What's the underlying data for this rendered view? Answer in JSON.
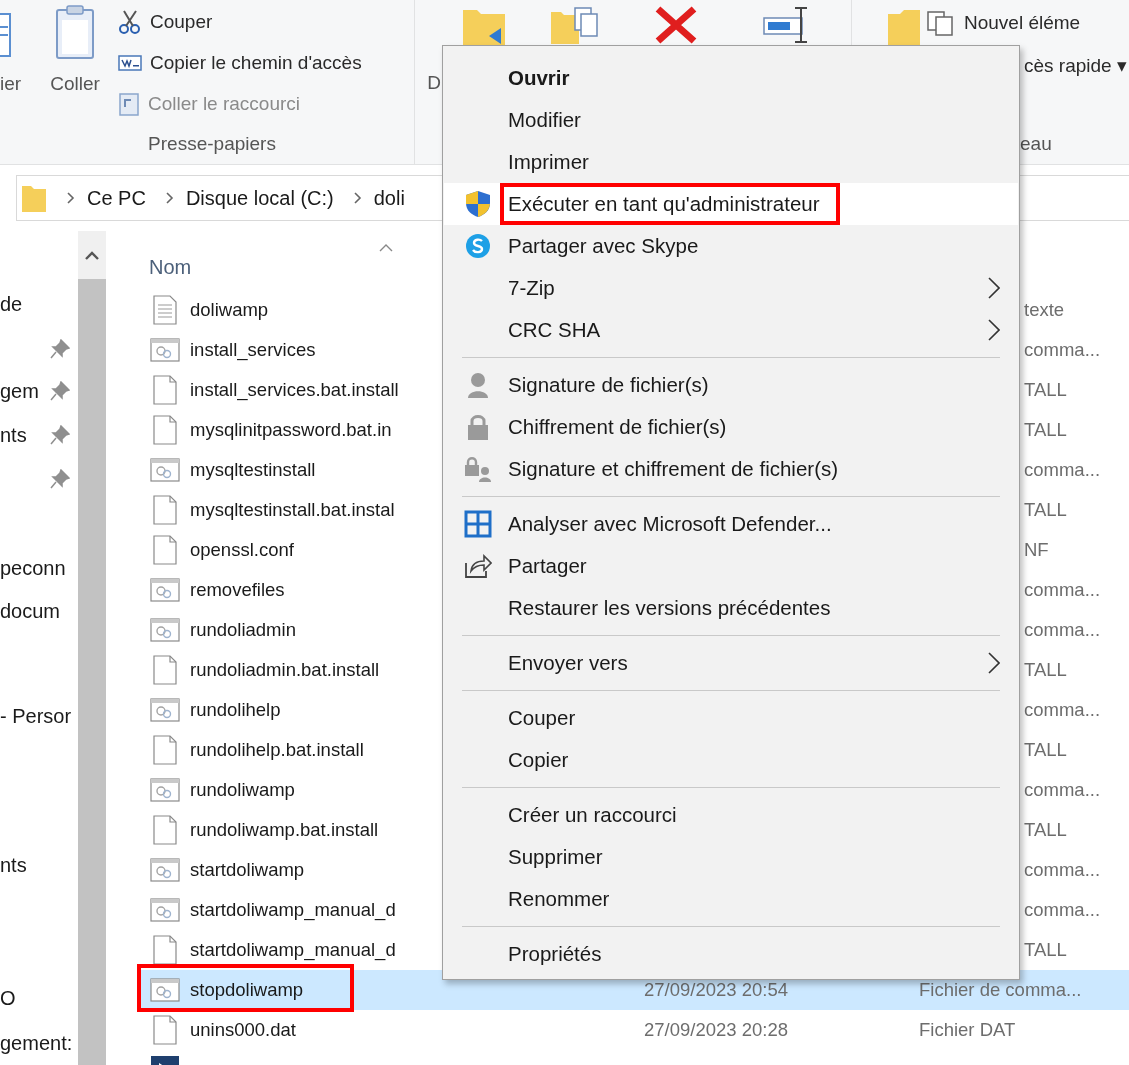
{
  "ribbon": {
    "clipboard": {
      "cut_label": "ier",
      "paste": "Coller",
      "actions": [
        {
          "label": "Couper",
          "disabled": false
        },
        {
          "label": "Copier le chemin d'accès",
          "disabled": false
        },
        {
          "label": "Coller le raccourci",
          "disabled": true
        }
      ],
      "group_label": "Presse-papiers"
    },
    "organize": {
      "cut_label": "D"
    },
    "new": {
      "actions": [
        "Nouvel éléme",
        "cès rapide ▾"
      ],
      "group_label": "eau"
    }
  },
  "address": {
    "crumbs": [
      "Ce PC",
      "Disque local (C:)",
      "doli"
    ]
  },
  "nav_pane": {
    "items": [
      {
        "label": "de",
        "pinned": false
      },
      {
        "pinned": true
      },
      {
        "label": "gem",
        "pinned": true
      },
      {
        "label": "nts",
        "pinned": true
      },
      {
        "pinned": true
      },
      {
        "label": "peconn",
        "pinned": false
      },
      {
        "label": "docum",
        "pinned": false
      },
      {
        "label": "- Persor",
        "pinned": false
      },
      {
        "label": "nts",
        "pinned": false
      },
      {
        "label": "O",
        "pinned": false
      },
      {
        "label": "gement:",
        "pinned": false
      }
    ]
  },
  "files": {
    "column": "Nom",
    "rows": [
      {
        "kind": "text",
        "name": "doliwamp",
        "type": "texte",
        "selected": false,
        "annotated": false
      },
      {
        "kind": "batch",
        "name": "install_services",
        "type": "comma...",
        "selected": false,
        "annotated": false
      },
      {
        "kind": "blank",
        "name": "install_services.bat.install",
        "type": "TALL",
        "selected": false,
        "annotated": false
      },
      {
        "kind": "blank",
        "name": "mysqlinitpassword.bat.in",
        "type": "TALL",
        "selected": false,
        "annotated": false
      },
      {
        "kind": "batch",
        "name": "mysqltestinstall",
        "type": "comma...",
        "selected": false,
        "annotated": false
      },
      {
        "kind": "blank",
        "name": "mysqltestinstall.bat.instal",
        "type": "TALL",
        "selected": false,
        "annotated": false
      },
      {
        "kind": "blank",
        "name": "openssl.conf",
        "type": "NF",
        "selected": false,
        "annotated": false
      },
      {
        "kind": "batch",
        "name": "removefiles",
        "type": "comma...",
        "selected": false,
        "annotated": false
      },
      {
        "kind": "batch",
        "name": "rundoliadmin",
        "type": "comma...",
        "selected": false,
        "annotated": false
      },
      {
        "kind": "blank",
        "name": "rundoliadmin.bat.install",
        "type": "TALL",
        "selected": false,
        "annotated": false
      },
      {
        "kind": "batch",
        "name": "rundolihelp",
        "type": "comma...",
        "selected": false,
        "annotated": false
      },
      {
        "kind": "blank",
        "name": "rundolihelp.bat.install",
        "type": "TALL",
        "selected": false,
        "annotated": false
      },
      {
        "kind": "batch",
        "name": "rundoliwamp",
        "type": "comma...",
        "selected": false,
        "annotated": false
      },
      {
        "kind": "blank",
        "name": "rundoliwamp.bat.install",
        "type": "TALL",
        "selected": false,
        "annotated": false
      },
      {
        "kind": "batch",
        "name": "startdoliwamp",
        "type": "comma...",
        "selected": false,
        "annotated": false
      },
      {
        "kind": "batch",
        "name": "startdoliwamp_manual_d",
        "type": "comma...",
        "selected": false,
        "annotated": false
      },
      {
        "kind": "blank",
        "name": "startdoliwamp_manual_d",
        "type": "TALL",
        "selected": false,
        "annotated": false
      },
      {
        "kind": "batch",
        "name": "stopdoliwamp",
        "date": "27/09/2023 20:54",
        "type": "Fichier de comma...",
        "selected": true,
        "annotated": true
      },
      {
        "kind": "blank",
        "name": "unins000.dat",
        "date": "27/09/2023 20:28",
        "type": "Fichier DAT",
        "selected": false,
        "annotated": false
      },
      {
        "kind": "app",
        "selected": false,
        "annotated": false
      }
    ]
  },
  "context_menu": {
    "items": [
      {
        "kind": "item",
        "label": "Ouvrir",
        "default": true,
        "submenu": false,
        "highlighted": false,
        "annotated": false
      },
      {
        "kind": "item",
        "label": "Modifier",
        "default": false,
        "submenu": false,
        "highlighted": false,
        "annotated": false
      },
      {
        "kind": "item",
        "label": "Imprimer",
        "default": false,
        "submenu": false,
        "highlighted": false,
        "annotated": false
      },
      {
        "kind": "item",
        "label": "Exécuter en tant qu'administrateur",
        "default": false,
        "submenu": false,
        "highlighted": true,
        "annotated": true
      },
      {
        "kind": "item",
        "label": "Partager avec Skype",
        "default": false,
        "submenu": false,
        "highlighted": false,
        "annotated": false
      },
      {
        "kind": "item",
        "label": "7-Zip",
        "default": false,
        "submenu": true,
        "highlighted": false,
        "annotated": false
      },
      {
        "kind": "item",
        "label": "CRC SHA",
        "default": false,
        "submenu": true,
        "highlighted": false,
        "annotated": false
      },
      {
        "kind": "separator"
      },
      {
        "kind": "item",
        "label": "Signature de fichier(s)",
        "default": false,
        "submenu": false,
        "highlighted": false,
        "annotated": false
      },
      {
        "kind": "item",
        "label": "Chiffrement de fichier(s)",
        "default": false,
        "submenu": false,
        "highlighted": false,
        "annotated": false
      },
      {
        "kind": "item",
        "label": "Signature et chiffrement de fichier(s)",
        "default": false,
        "submenu": false,
        "highlighted": false,
        "annotated": false
      },
      {
        "kind": "separator"
      },
      {
        "kind": "item",
        "label": "Analyser avec Microsoft Defender...",
        "default": false,
        "submenu": false,
        "highlighted": false,
        "annotated": false
      },
      {
        "kind": "item",
        "label": "Partager",
        "default": false,
        "submenu": false,
        "highlighted": false,
        "annotated": false
      },
      {
        "kind": "item",
        "label": "Restaurer les versions précédentes",
        "default": false,
        "submenu": false,
        "highlighted": false,
        "annotated": false
      },
      {
        "kind": "separator"
      },
      {
        "kind": "item",
        "label": "Envoyer vers",
        "default": false,
        "submenu": true,
        "highlighted": false,
        "annotated": false
      },
      {
        "kind": "separator"
      },
      {
        "kind": "item",
        "label": "Couper",
        "default": false,
        "submenu": false,
        "highlighted": false,
        "annotated": false
      },
      {
        "kind": "item",
        "label": "Copier",
        "default": false,
        "submenu": false,
        "highlighted": false,
        "annotated": false
      },
      {
        "kind": "separator"
      },
      {
        "kind": "item",
        "label": "Créer un raccourci",
        "default": false,
        "submenu": false,
        "highlighted": false,
        "annotated": false
      },
      {
        "kind": "item",
        "label": "Supprimer",
        "default": false,
        "submenu": false,
        "highlighted": false,
        "annotated": false
      },
      {
        "kind": "item",
        "label": "Renommer",
        "default": false,
        "submenu": false,
        "highlighted": false,
        "annotated": false
      },
      {
        "kind": "separator"
      },
      {
        "kind": "item",
        "label": "Propriétés",
        "default": false,
        "submenu": false,
        "highlighted": false,
        "annotated": false
      }
    ]
  }
}
